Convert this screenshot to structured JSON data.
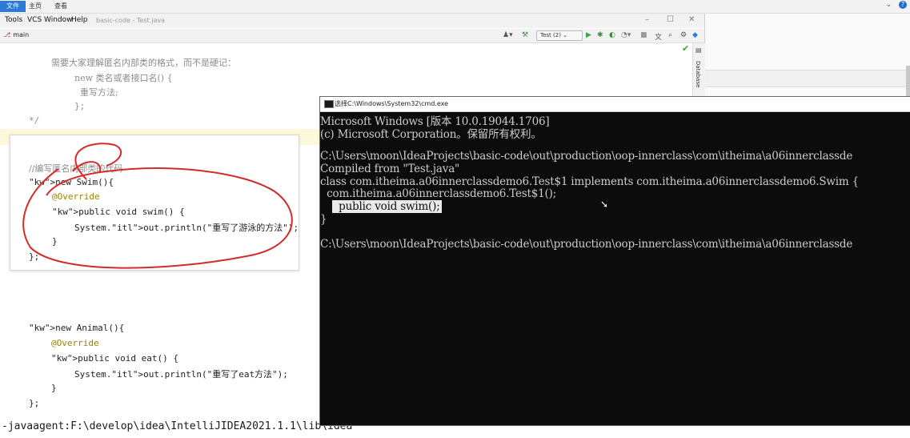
{
  "ribbon": {
    "tabs": [
      "文件",
      "主页",
      "查看"
    ],
    "right": "⌄"
  },
  "ide": {
    "menu": [
      "Tools",
      "VCS",
      "Window",
      "Help"
    ],
    "title": "basic-code - Test.java",
    "branch": "main",
    "run_config": "Test (2)",
    "right_panel_label": "Database",
    "code_top": [
      "需要大家理解匿名内部类的格式，而不是硬记：",
      "new 类名或者接口名() {",
      "重写方法;",
      "};",
      "*/"
    ],
    "card_code": [
      "//编写匿名内部类的代码",
      "new Swim(){",
      "@Override",
      "public void swim() {",
      "System.out.println(\"重写了游泳的方法\");",
      "}",
      "};"
    ],
    "code_bottom": [
      "new Animal(){",
      "@Override",
      "public void eat() {",
      "System.out.println(\"重写了eat方法\");",
      "}",
      "};"
    ],
    "cmdline_bottom": "-javaagent:F:\\develop\\idea\\IntelliJIDEA2021.1.1\\lib\\idea"
  },
  "cmd": {
    "title": "选择C:\\Windows\\System32\\cmd.exe",
    "lines": [
      "Microsoft Windows [版本 10.0.19044.1706]",
      "(c) Microsoft Corporation。保留所有权利。",
      "",
      "C:\\Users\\moon\\IdeaProjects\\basic-code\\out\\production\\oop-innerclass\\com\\itheima\\a06innerclassde",
      "Compiled from \"Test.java\"",
      "class com.itheima.a06innerclassdemo6.Test$1 implements com.itheima.a06innerclassdemo6.Swim {",
      "  com.itheima.a06innerclassdemo6.Test$1();",
      "  public void swim();",
      "}",
      "",
      "C:\\Users\\moon\\IdeaProjects\\basic-code\\out\\production\\oop-innerclass\\com\\itheima\\a06innerclassde"
    ],
    "selected_line_index": 7
  },
  "colors": {
    "accent": "#2b79d8",
    "annotation_red": "#d42a2a",
    "console_bg": "#0c0c0c"
  }
}
